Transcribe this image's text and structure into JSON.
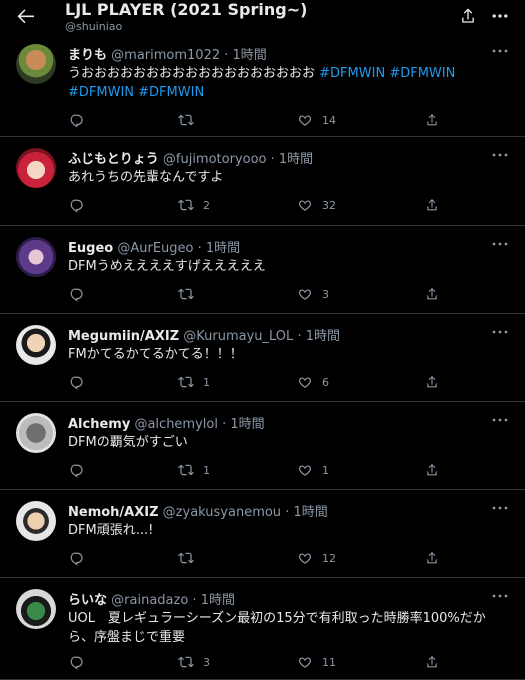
{
  "header": {
    "title": "LJL PLAYER (2021 Spring~)",
    "subtitle": "@shuiniao"
  },
  "tweets": [
    {
      "name": "まりも",
      "handle": "@marimom1022",
      "time": "1時間",
      "text": "うおおおおおおおおおおおおおおおおおお",
      "hashtags": [
        "#DFMWIN",
        "#DFMWIN",
        "#DFMWIN",
        "#DFMWIN"
      ],
      "reply_count": "",
      "retweet_count": "",
      "like_count": "14"
    },
    {
      "name": "ふじもとりょう",
      "handle": "@fujimotoryooo",
      "time": "1時間",
      "text": "あれうちの先輩なんですよ",
      "hashtags": [],
      "reply_count": "",
      "retweet_count": "2",
      "like_count": "32"
    },
    {
      "name": "Eugeo",
      "handle": "@AurEugeo",
      "time": "1時間",
      "text": "DFMうめええええすげえええええ",
      "hashtags": [],
      "reply_count": "",
      "retweet_count": "",
      "like_count": "3"
    },
    {
      "name": "Megumiin/AXIZ",
      "handle": "@Kurumayu_LOL",
      "time": "1時間",
      "text": "FMかてるかてるかてる！！！",
      "hashtags": [],
      "reply_count": "",
      "retweet_count": "1",
      "like_count": "6"
    },
    {
      "name": "Alchemy",
      "handle": "@alchemylol",
      "time": "1時間",
      "text": "DFMの覇気がすごい",
      "hashtags": [],
      "reply_count": "",
      "retweet_count": "1",
      "like_count": "1"
    },
    {
      "name": "Nemoh/AXIZ",
      "handle": "@zyakusyanemou",
      "time": "1時間",
      "text": "DFM頑張れ...!",
      "hashtags": [],
      "reply_count": "",
      "retweet_count": "",
      "like_count": "12"
    },
    {
      "name": "らいな",
      "handle": "@rainadazo",
      "time": "1時間",
      "text": "UOL　夏レギュラーシーズン最初の15分で有利取った時勝率100%だから、序盤まじで重要",
      "hashtags": [],
      "reply_count": "",
      "retweet_count": "3",
      "like_count": "11"
    }
  ],
  "icons": {
    "back": "arrow-left-icon",
    "share": "share-icon",
    "more": "more-icon",
    "reply": "reply-icon",
    "retweet": "retweet-icon",
    "like": "heart-icon",
    "tweet_share": "share-icon"
  },
  "colors": {
    "background": "#000000",
    "divider": "#2f3336",
    "text": "#e7e9ea",
    "muted": "#8b98a5",
    "hashtag": "#1d9bf0"
  }
}
